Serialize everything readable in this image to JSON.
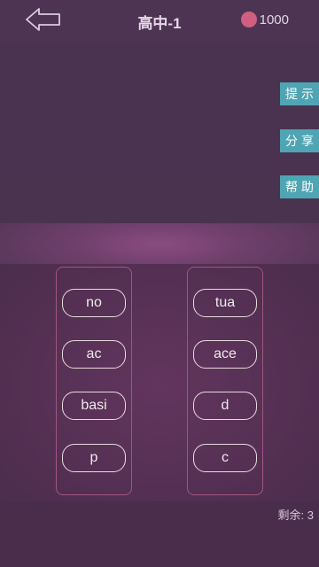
{
  "header": {
    "title": "高中-1",
    "coins": "1000"
  },
  "side_buttons": {
    "hint": "提示",
    "share": "分享",
    "help": "帮助"
  },
  "left_column": [
    "no",
    "ac",
    "basi",
    "p"
  ],
  "right_column": [
    "tua",
    "ace",
    "d",
    "c"
  ],
  "footer": {
    "remaining": "剩余: 3"
  },
  "colors": {
    "background": "#4a3452",
    "accent_button": "#4fa5b3",
    "coin": "#cf5f80",
    "column_border": "#a0577e"
  }
}
